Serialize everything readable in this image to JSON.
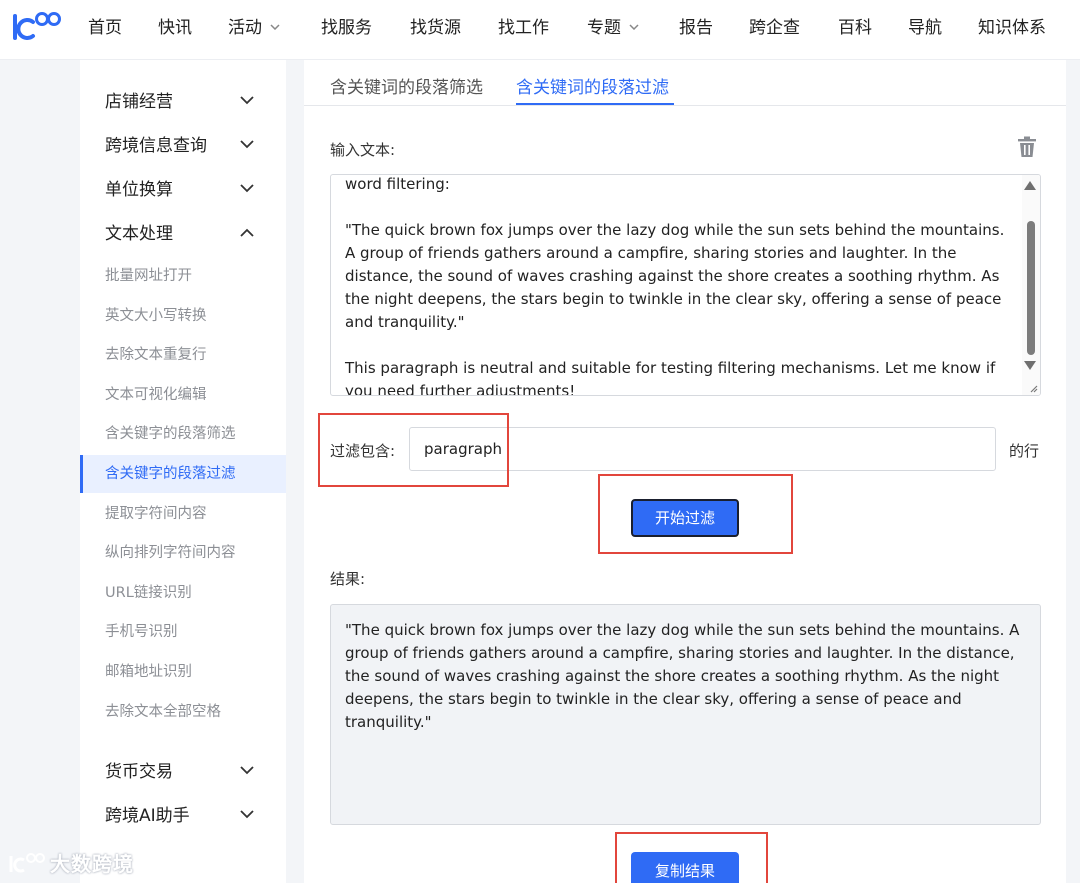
{
  "nav": {
    "items": [
      "首页",
      "快讯",
      "活动",
      "找服务",
      "找货源",
      "找工作",
      "专题",
      "报告",
      "跨企查",
      "百科",
      "导航",
      "知识体系"
    ]
  },
  "sidebar": {
    "groups": {
      "store": "店铺经营",
      "info": "跨境信息查询",
      "unit": "单位换算",
      "text": "文本处理",
      "currency": "货币交易",
      "ai": "跨境AI助手"
    },
    "text_items": [
      "批量网址打开",
      "英文大小写转换",
      "去除文本重复行",
      "文本可视化编辑",
      "含关键字的段落筛选",
      "含关键字的段落过滤",
      "提取字符间内容",
      "纵向排列字符间内容",
      "URL链接识别",
      "手机号识别",
      "邮箱地址识别",
      "去除文本全部空格"
    ],
    "active_item": "含关键字的段落过滤"
  },
  "tabs": [
    "含关键词的段落筛选",
    "含关键词的段落过滤"
  ],
  "active_tab": "含关键词的段落过滤",
  "input": {
    "label": "输入文本:",
    "text": "word filtering:\n\n\"The quick brown fox jumps over the lazy dog while the sun sets behind the mountains. A group of friends gathers around a campfire, sharing stories and laughter. In the distance, the sound of waves crashing against the shore creates a soothing rhythm. As the night deepens, the stars begin to twinkle in the clear sky, offering a sense of peace and tranquility.\"\n\nThis paragraph is neutral and suitable for testing filtering mechanisms. Let me know if you need further adjustments!"
  },
  "filter": {
    "label": "过滤包含:",
    "value": "paragraph",
    "suffix": "的行"
  },
  "start_button": "开始过滤",
  "result": {
    "label": "结果:",
    "text": "\"The quick brown fox jumps over the lazy dog while the sun sets behind the mountains. A group of friends gathers around a campfire, sharing stories and laughter. In the distance, the sound of waves crashing against the shore creates a soothing rhythm. As the night deepens, the stars begin to twinkle in the clear sky, offering a sense of peace and tranquility.\""
  },
  "copy_button": "复制结果",
  "watermark": "大数跨境",
  "icons": [
    "logo-icon",
    "chevron-down-icon",
    "chevron-up-icon",
    "trash-icon"
  ],
  "colors": {
    "accent": "#2f6bf5",
    "highlight_border": "#e2463c",
    "active_bg": "#e9f0ff"
  }
}
